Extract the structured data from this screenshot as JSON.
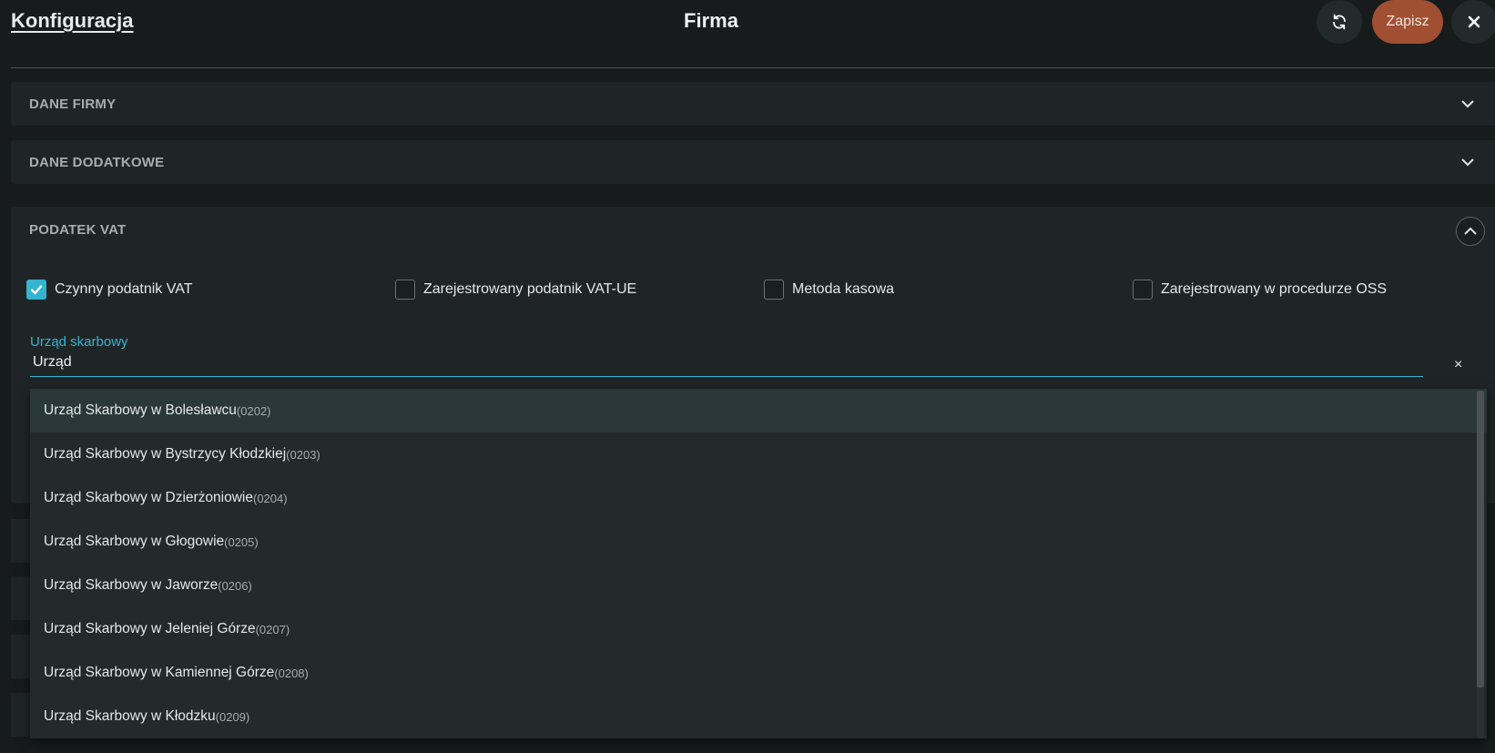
{
  "header": {
    "breadcrumb": "Konfiguracja",
    "title": "Firma",
    "refresh_icon": "refresh-icon",
    "save_label": "Zapisz",
    "close_icon": "close-icon"
  },
  "sections": [
    {
      "label": "DANE FIRMY",
      "expanded": false
    },
    {
      "label": "DANE DODATKOWE",
      "expanded": false
    },
    {
      "label": "PODATEK VAT",
      "expanded": true
    }
  ],
  "vat": {
    "checkboxes": [
      {
        "label": "Czynny podatnik VAT",
        "checked": true
      },
      {
        "label": "Zarejestrowany podatnik VAT-UE",
        "checked": false
      },
      {
        "label": "Metoda kasowa",
        "checked": false
      },
      {
        "label": "Zarejestrowany w procedurze OSS",
        "checked": false
      }
    ],
    "tax_office_label": "Urząd skarbowy",
    "tax_office_value": "Urząd",
    "clear_icon": "×"
  },
  "dropdown": {
    "options": [
      {
        "name": "Urząd Skarbowy w Bolesławcu",
        "code": "(0202)"
      },
      {
        "name": "Urząd Skarbowy w Bystrzycy Kłodzkiej",
        "code": "(0203)"
      },
      {
        "name": "Urząd Skarbowy w Dzierżoniowie",
        "code": "(0204)"
      },
      {
        "name": "Urząd Skarbowy w Głogowie",
        "code": "(0205)"
      },
      {
        "name": "Urząd Skarbowy w Jaworze",
        "code": "(0206)"
      },
      {
        "name": "Urząd Skarbowy w Jeleniej Górze",
        "code": "(0207)"
      },
      {
        "name": "Urząd Skarbowy w Kamiennej Górze",
        "code": "(0208)"
      },
      {
        "name": "Urząd Skarbowy w Kłodzku",
        "code": "(0209)"
      }
    ]
  },
  "colors": {
    "accent": "#36b3cf",
    "save_button": "#a04f33",
    "background": "#171b1c",
    "panel": "#1f2526"
  }
}
